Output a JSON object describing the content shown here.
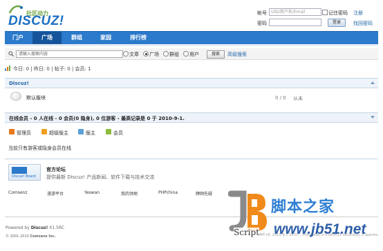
{
  "header": {
    "logo_text": "DISCUZ!",
    "logo_sub": "社区动力",
    "login": {
      "account_label": "帐号",
      "account_placeholder": "UID/用户名/Email",
      "remember_label": "记住密码",
      "register_link": "注册",
      "password_label": "密码",
      "login_button": "登录",
      "recover_link": "找回密码"
    }
  },
  "nav": {
    "items": [
      {
        "label": "门户"
      },
      {
        "label": "广场"
      },
      {
        "label": "群组"
      },
      {
        "label": "家园"
      },
      {
        "label": "排行榜"
      }
    ]
  },
  "search": {
    "placeholder": "请输入搜索内容",
    "options": [
      "文章",
      "广场",
      "群组",
      "用户"
    ],
    "selected": "广场",
    "button": "搜索",
    "advanced_link": "高级搜索"
  },
  "stats": {
    "text": "今日: 0 | 昨日: 0 | 帖子: 0 | 会员: 1"
  },
  "category": {
    "title": "Discuz!",
    "forum_name": "默认版块",
    "counts": "0 / 0",
    "last_post": "从未"
  },
  "online": {
    "title": "在线会员 - 0 人在线 - 0 会员(0 隐身), 0 位游客 - 最高记录是 0 于 2010-9-1.",
    "roles": [
      {
        "label": "管理员",
        "color": "#e8781a"
      },
      {
        "label": "超级版主",
        "color": "#f0a020"
      },
      {
        "label": "版主",
        "color": "#5aa0d8"
      },
      {
        "label": "会员",
        "color": "#8cbc40"
      }
    ],
    "note": "当前只有游客或隐身会员在线"
  },
  "official": {
    "title": "官方论坛",
    "desc": "提供最新 Discuz! 产品新闻、软件下载与技术交流",
    "banner_text": "Discuz! Board",
    "partners": [
      "Comsenz",
      "漫游平台",
      "Yeswan",
      "我的领地",
      "PHPchina",
      "牌网先疑"
    ]
  },
  "footer": {
    "powered": "Powered by",
    "product": "Discuz!",
    "version": "X1.5RC",
    "copyright": "© 2001-2010",
    "company": "Comsenz Inc.",
    "right_text": "GMT+8, 2010-9-1 14:07 , Processed in 0.084431 second(s), 8 queries ."
  },
  "watermark": {
    "brand": "脚本之家",
    "script_word": "Script",
    "url": "www.jb51.net"
  }
}
